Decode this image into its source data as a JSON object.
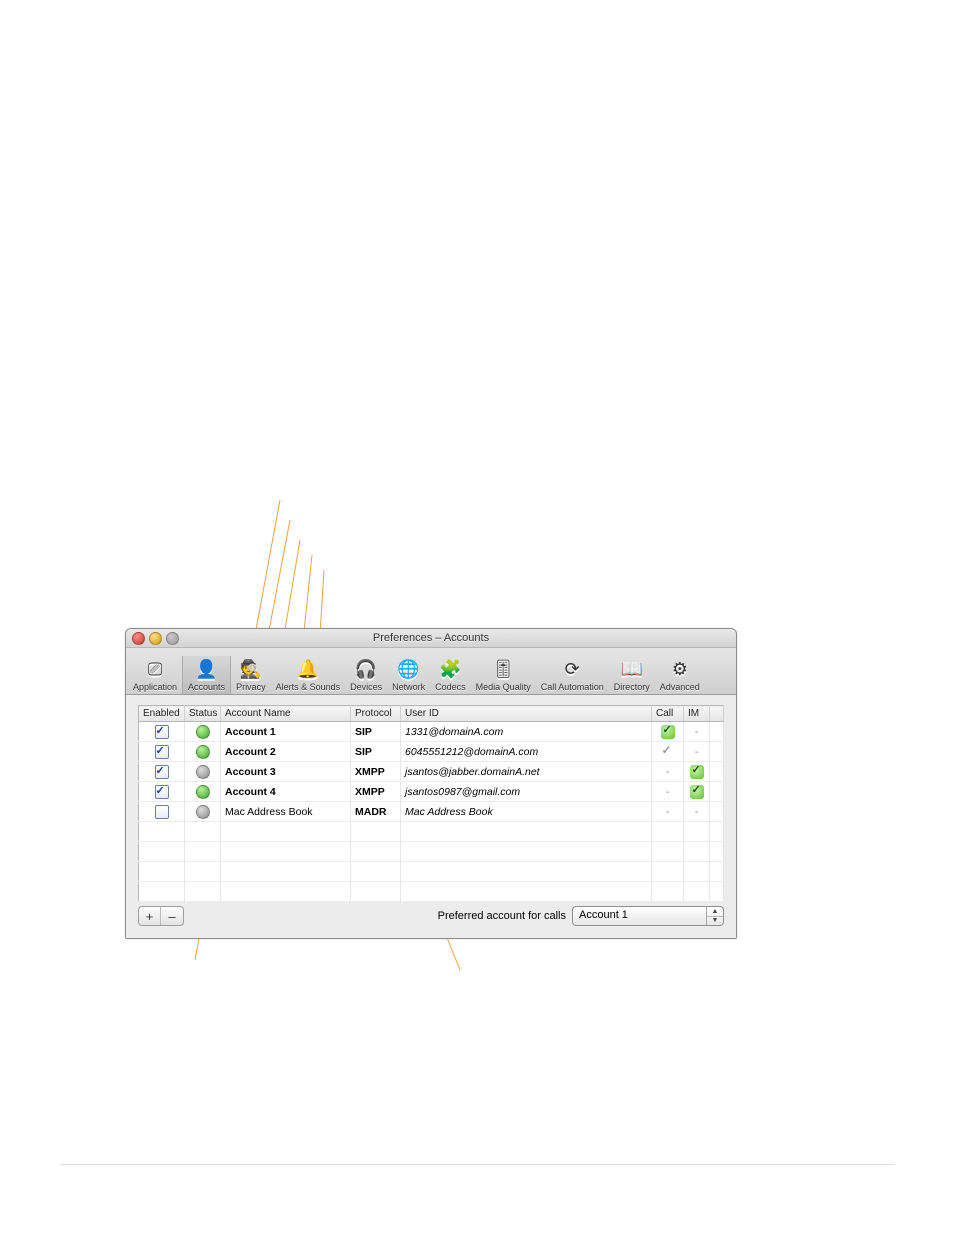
{
  "window": {
    "title": "Preferences – Accounts"
  },
  "toolbar": {
    "items": [
      {
        "id": "application",
        "label": "Application",
        "icon": "⎚"
      },
      {
        "id": "accounts",
        "label": "Accounts",
        "icon": "👤",
        "selected": true
      },
      {
        "id": "privacy",
        "label": "Privacy",
        "icon": "🕵️"
      },
      {
        "id": "alerts",
        "label": "Alerts & Sounds",
        "icon": "🔔"
      },
      {
        "id": "devices",
        "label": "Devices",
        "icon": "🎧"
      },
      {
        "id": "network",
        "label": "Network",
        "icon": "🌐"
      },
      {
        "id": "codecs",
        "label": "Codecs",
        "icon": "🧩"
      },
      {
        "id": "mediaq",
        "label": "Media Quality",
        "icon": "🎚"
      },
      {
        "id": "callauto",
        "label": "Call Automation",
        "icon": "⟳"
      },
      {
        "id": "directory",
        "label": "Directory",
        "icon": "📖"
      },
      {
        "id": "advanced",
        "label": "Advanced",
        "icon": "⚙"
      }
    ]
  },
  "columns": {
    "enabled": "Enabled",
    "status": "Status",
    "name": "Account Name",
    "protocol": "Protocol",
    "userid": "User ID",
    "call": "Call",
    "im": "IM"
  },
  "rows": [
    {
      "enabled": true,
      "status": "green",
      "name": "Account 1",
      "bold": true,
      "protocol": "SIP",
      "userid": "1331@domainA.com",
      "call": "green-tick",
      "im": "-"
    },
    {
      "enabled": true,
      "status": "green",
      "name": "Account 2",
      "bold": true,
      "protocol": "SIP",
      "userid": "6045551212@domainA.com",
      "call": "gray-tick",
      "im": "-"
    },
    {
      "enabled": true,
      "status": "gray",
      "name": "Account 3",
      "bold": true,
      "protocol": "XMPP",
      "userid": "jsantos@jabber.domainA.net",
      "call": "-",
      "im": "green-tick"
    },
    {
      "enabled": true,
      "status": "green",
      "name": "Account 4",
      "bold": true,
      "protocol": "XMPP",
      "userid": "jsantos0987@gmail.com",
      "call": "-",
      "im": "green-tick"
    },
    {
      "enabled": false,
      "status": "gray",
      "name": "Mac Address Book",
      "bold": false,
      "protocol": "MADR",
      "userid": "Mac Address Book",
      "call": "-",
      "im": "-"
    }
  ],
  "empty_rows": 4,
  "footer": {
    "add": "+",
    "remove": "–",
    "label": "Preferred account for calls",
    "selected": "Account 1"
  }
}
